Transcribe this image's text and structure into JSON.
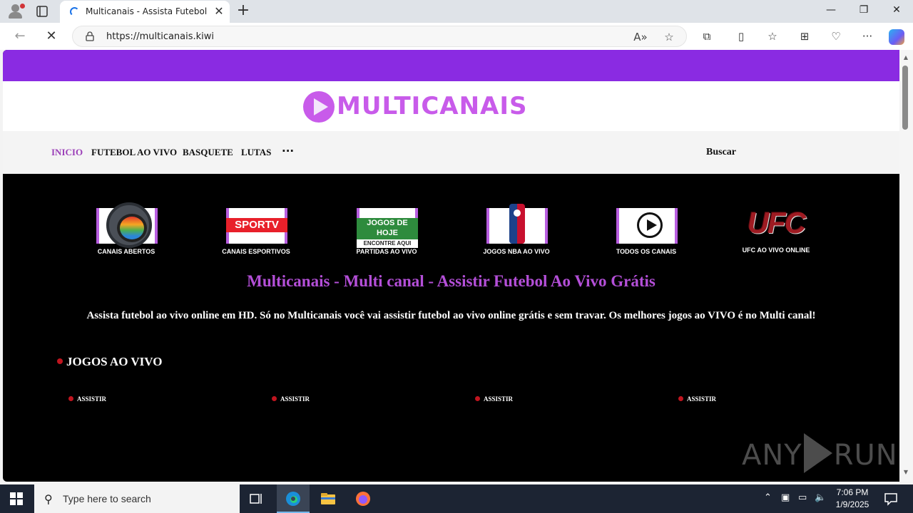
{
  "browser": {
    "tab_title": "Multicanais - Assista Futebol Ao",
    "url": "https://multicanais.kiwi",
    "window_controls": [
      "minimize",
      "restore",
      "close"
    ]
  },
  "site": {
    "logo_text": "MULTICANAIS",
    "menu": {
      "items": [
        {
          "label": "INICIO",
          "active": true
        },
        {
          "label": "FUTEBOL AO VIVO",
          "active": false
        },
        {
          "label": "BASQUETE",
          "active": false
        },
        {
          "label": "LUTAS",
          "active": false
        }
      ],
      "more": "···",
      "search_label": "Buscar"
    },
    "channels": [
      {
        "label": "CANAIS ABERTOS",
        "icon": "globo-icon"
      },
      {
        "label": "CANAIS ESPORTIVOS",
        "icon": "sportv-icon",
        "logo_text": "SPORTV"
      },
      {
        "label": "PARTIDAS AO VIVO",
        "icon": "jogos-de-hoje-icon",
        "logo_text": "JOGOS DE HOJE",
        "logo_sub": "ENCONTRE AQUI"
      },
      {
        "label": "JOGOS NBA AO VIVO",
        "icon": "nba-icon"
      },
      {
        "label": "TODOS OS CANAIS",
        "icon": "play-icon"
      },
      {
        "label": "UFC AO VIVO ONLINE",
        "icon": "ufc-icon",
        "logo_text": "UFC"
      }
    ],
    "page_title": "Multicanais - Multi canal - Assistir Futebol Ao Vivo Grátis",
    "intro": "Assista futebol ao vivo online em HD. Só no Multicanais você vai assistir futebol ao vivo online grátis e sem travar. Os melhores jogos ao VIVO é no Multi canal!",
    "live_section_title": "JOGOS AO VIVO",
    "watch_links": [
      "ASSISTIR",
      "ASSISTIR",
      "ASSISTIR",
      "ASSISTIR"
    ],
    "watermark": {
      "left": "ANY",
      "right": "RUN"
    }
  },
  "taskbar": {
    "search_placeholder": "Type here to search",
    "time": "7:06 PM",
    "date": "1/9/2025"
  },
  "colors": {
    "accent_purple": "#8a2be2",
    "logo_purple": "#c85bea",
    "title_purple": "#b44fd8",
    "live_dot_red": "#c0151f"
  }
}
